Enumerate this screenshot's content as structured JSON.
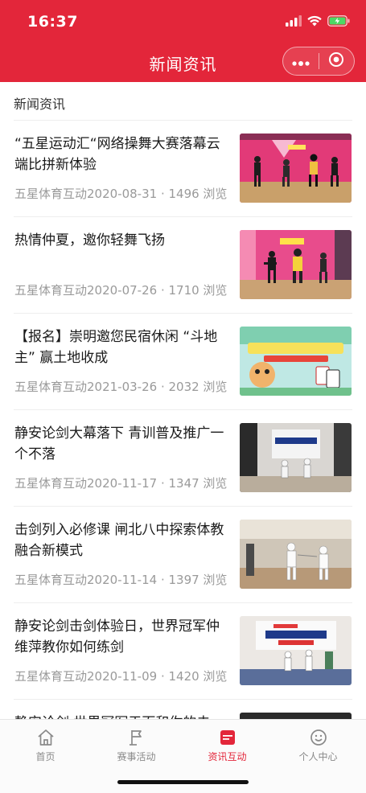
{
  "status_bar": {
    "time": "16:37"
  },
  "nav": {
    "title": "新闻资讯"
  },
  "section": {
    "label": "新闻资讯"
  },
  "articles": [
    {
      "title": "“五星运动汇“网络操舞大赛落幕云端比拼新体验",
      "meta": "五星体育互动2020-08-31 · 1496 浏览",
      "thumb": "dance-stage-pink"
    },
    {
      "title": "热情仲夏，邀你轻舞飞扬",
      "meta": "五星体育互动2020-07-26 · 1710 浏览",
      "thumb": "dance-stage-pink"
    },
    {
      "title": "【报名】崇明邀您民宿休闲 “斗地主” 赢土地收成",
      "meta": "五星体育互动2021-03-26 · 2032 浏览",
      "thumb": "poker-poster"
    },
    {
      "title": "静安论剑大幕落下 青训普及推广一个不落",
      "meta": "五星体育互动2020-11-17 · 1347 浏览",
      "thumb": "fencing-hall"
    },
    {
      "title": "击剑列入必修课 闸北八中探索体教融合新模式",
      "meta": "五星体育互动2020-11-14 · 1397 浏览",
      "thumb": "fencing-class"
    },
    {
      "title": "静安论剑击剑体验日，世界冠军仲维萍教你如何练剑",
      "meta": "五星体育互动2020-11-09 · 1420 浏览",
      "thumb": "fencing-show"
    },
    {
      "title": "静安论剑 世界冠军于面和你的未",
      "meta": "",
      "thumb": "fencing-hall"
    }
  ],
  "tabs": [
    {
      "label": "首页",
      "icon": "home-icon"
    },
    {
      "label": "赛事活动",
      "icon": "flag-icon"
    },
    {
      "label": "资讯互动",
      "icon": "news-icon"
    },
    {
      "label": "个人中心",
      "icon": "smile-icon"
    }
  ],
  "colors": {
    "brand": "#e3263a",
    "muted": "#9a9a9a"
  }
}
